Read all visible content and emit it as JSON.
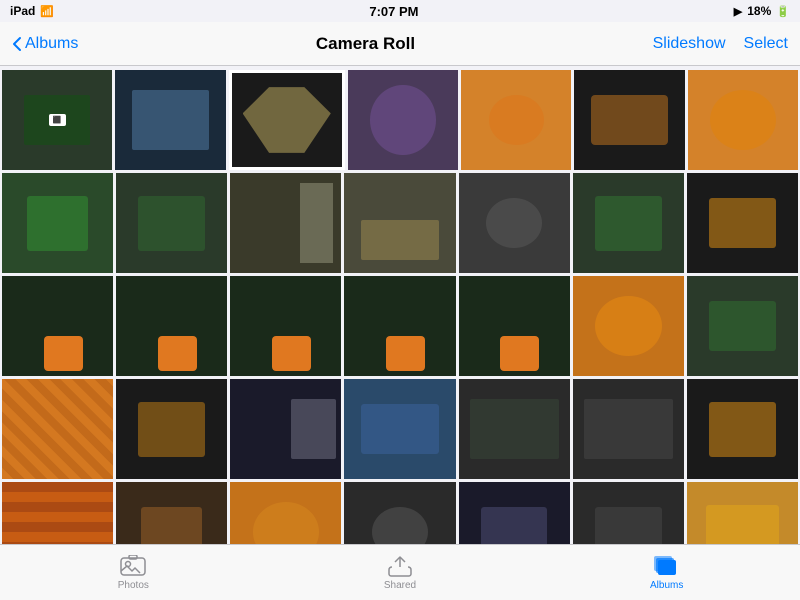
{
  "statusBar": {
    "device": "iPad",
    "wifi": "wifi",
    "time": "7:07 PM",
    "signal": "▶",
    "battery": "18%"
  },
  "navBar": {
    "backLabel": "Albums",
    "title": "Camera Roll",
    "slideshow": "Slideshow",
    "select": "Select"
  },
  "grid": {
    "rows": [
      [
        "r1t1",
        "r1t2",
        "r1t3",
        "r1t4",
        "r1t5",
        "r1t6",
        "r1t7"
      ],
      [
        "r2t1",
        "r2t2",
        "r2t3",
        "r2t4",
        "r2t5",
        "r2t6",
        "r2t7"
      ],
      [
        "r3t1",
        "r3t2",
        "r3t3",
        "r3t4",
        "r3t5",
        "r3t6",
        "r3t7"
      ],
      [
        "r4t1",
        "r4t2",
        "r4t3",
        "r4t4",
        "r4t5",
        "r4t6",
        "r4t7"
      ],
      [
        "r5t1",
        "r5t2",
        "r5t3",
        "r5t4",
        "r5t5",
        "r5t6",
        "r5t7"
      ]
    ]
  },
  "tabBar": {
    "tabs": [
      {
        "id": "photos",
        "label": "Photos",
        "active": false
      },
      {
        "id": "shared",
        "label": "Shared",
        "active": false
      },
      {
        "id": "albums",
        "label": "Albums",
        "active": true
      }
    ]
  }
}
